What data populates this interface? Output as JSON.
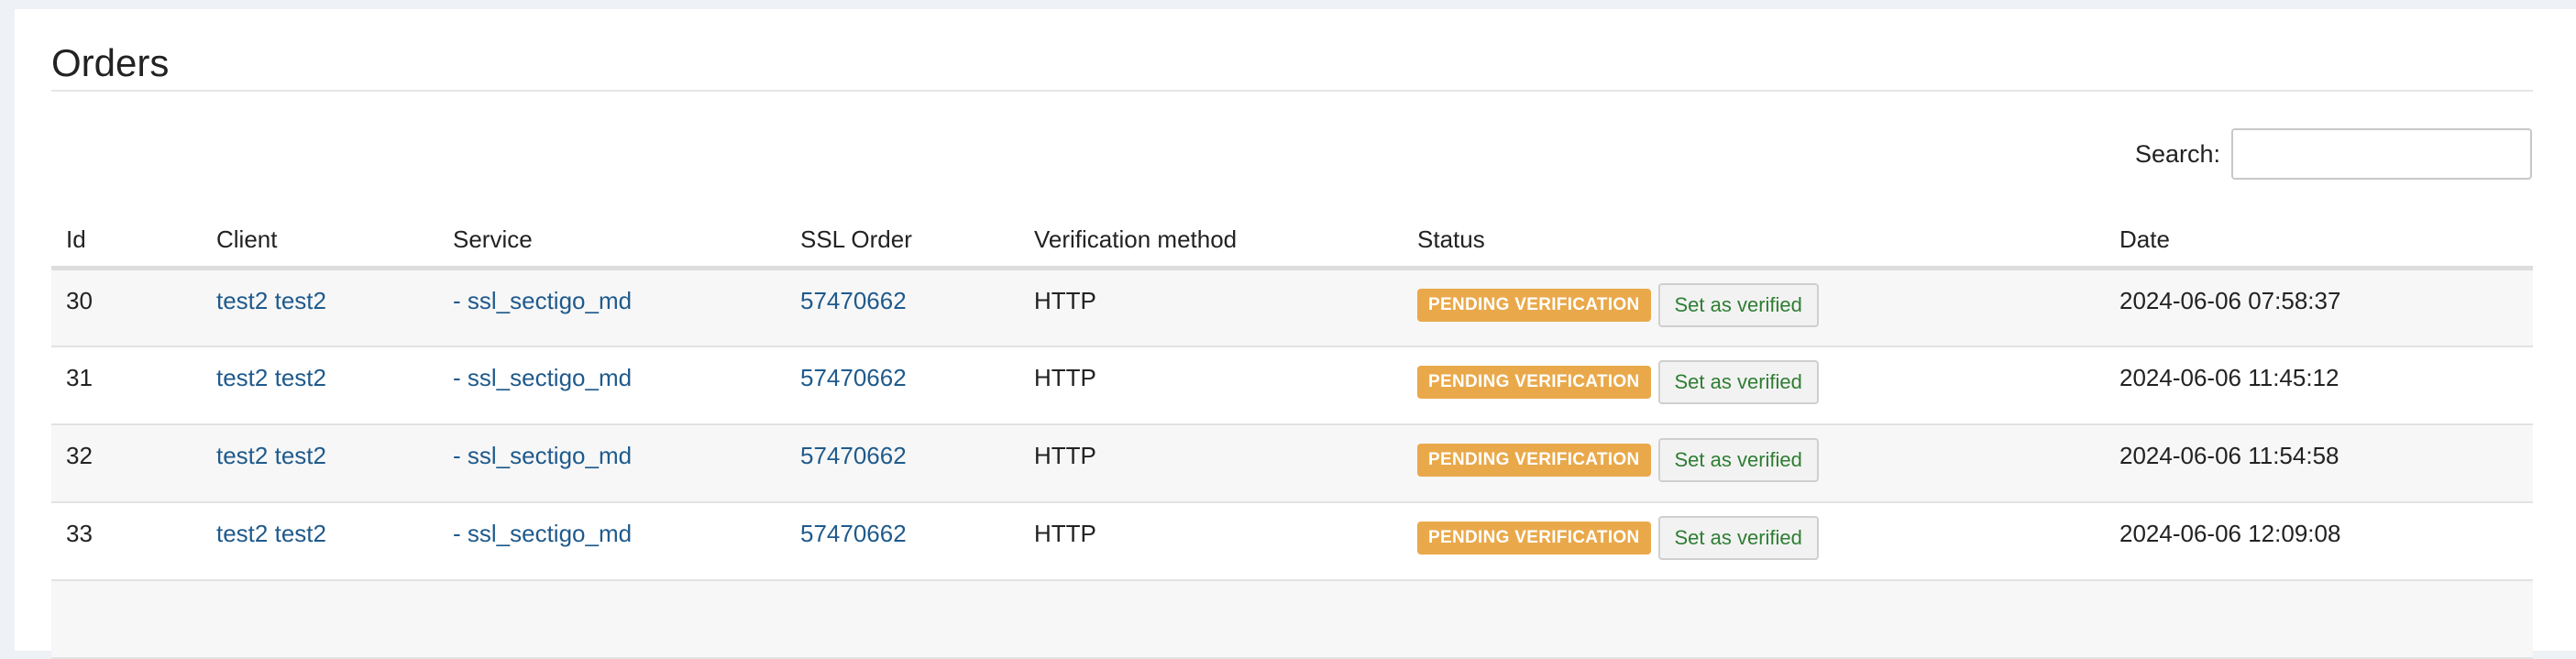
{
  "page": {
    "title": "Orders"
  },
  "search": {
    "label": "Search:",
    "value": "",
    "placeholder": ""
  },
  "table": {
    "headers": {
      "id": "Id",
      "client": "Client",
      "service": "Service",
      "ssl_order": "SSL Order",
      "verification_method": "Verification method",
      "status": "Status",
      "date": "Date"
    },
    "rows": [
      {
        "id": "30",
        "client": "test2 test2",
        "service": "- ssl_sectigo_md",
        "ssl_order": "57470662",
        "verification_method": "HTTP",
        "status": "PENDING VERIFICATION",
        "action": "Set as verified",
        "date": "2024-06-06 07:58:37"
      },
      {
        "id": "31",
        "client": "test2 test2",
        "service": "- ssl_sectigo_md",
        "ssl_order": "57470662",
        "verification_method": "HTTP",
        "status": "PENDING VERIFICATION",
        "action": "Set as verified",
        "date": "2024-06-06 11:45:12"
      },
      {
        "id": "32",
        "client": "test2 test2",
        "service": "- ssl_sectigo_md",
        "ssl_order": "57470662",
        "verification_method": "HTTP",
        "status": "PENDING VERIFICATION",
        "action": "Set as verified",
        "date": "2024-06-06 11:54:58"
      },
      {
        "id": "33",
        "client": "test2 test2",
        "service": "- ssl_sectigo_md",
        "ssl_order": "57470662",
        "verification_method": "HTTP",
        "status": "PENDING VERIFICATION",
        "action": "Set as verified",
        "date": "2024-06-06 12:09:08"
      }
    ]
  },
  "colors": {
    "badge_pending": "#e9a94b",
    "link": "#1f5a8c",
    "verify_text": "#2e7d32"
  }
}
